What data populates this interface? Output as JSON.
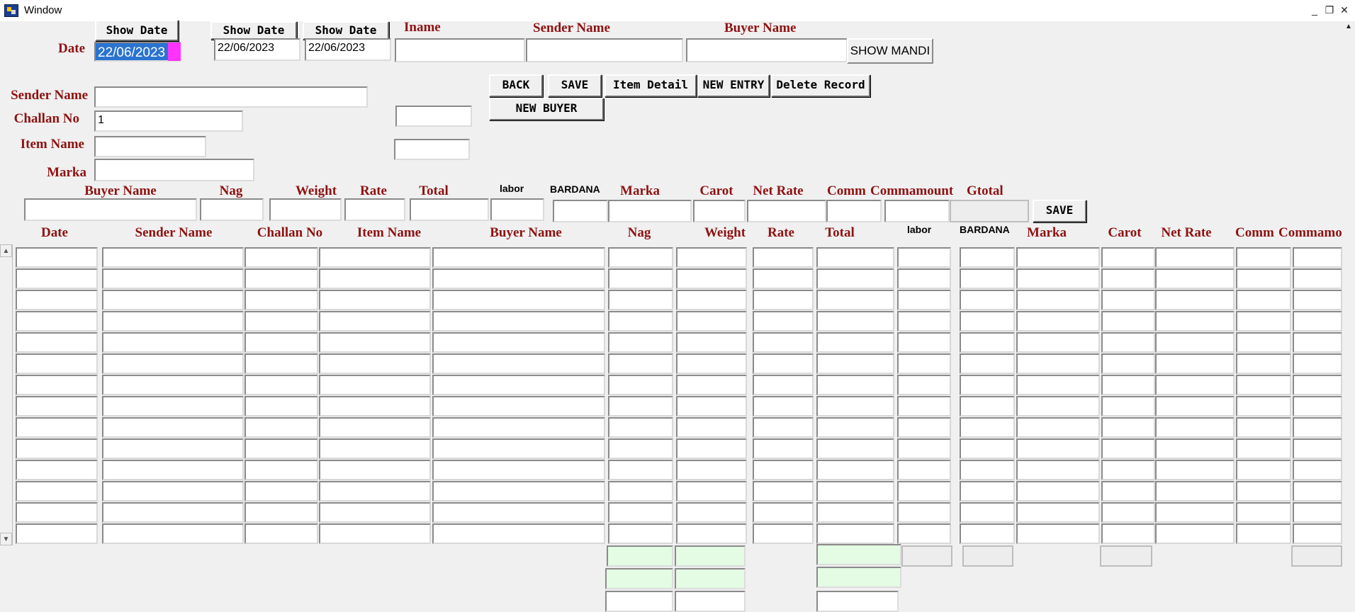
{
  "window": {
    "title": "Window",
    "minimize": "_",
    "restore": "❐",
    "close": "✕"
  },
  "top": {
    "date_label": "Date",
    "date_value": "22/06/2023",
    "show_date_1": "Show Date",
    "show_date_2": "Show Date",
    "show_date_3": "Show Date",
    "date_from": "22/06/2023",
    "date_to": "22/06/2023",
    "iname_label": "Iname",
    "sender_name_label": "Sender Name",
    "buyer_name_label": "Buyer Name",
    "show_mandi": "SHOW MANDI"
  },
  "form": {
    "sender_name_label": "Sender Name",
    "challan_no_label": "Challan No",
    "challan_no_value": "1",
    "item_name_label": "Item Name",
    "marka_label": "Marka"
  },
  "actions": {
    "back": "BACK",
    "save": "SAVE",
    "item_detail": "Item Detail",
    "new_entry": "NEW ENTRY",
    "delete_record": "Delete Record",
    "new_buyer": "NEW BUYER"
  },
  "entry": {
    "buyer_name": "Buyer Name",
    "nag": "Nag",
    "weight": "Weight",
    "rate": "Rate",
    "total": "Total",
    "labor": "labor",
    "bardana": "BARDANA",
    "marka": "Marka",
    "carot": "Carot",
    "net_rate": "Net Rate",
    "comm": "Comm",
    "commamount": "Commamount",
    "gtotal": "Gtotal",
    "save": "SAVE"
  },
  "grid": {
    "date": "Date",
    "sender_name": "Sender Name",
    "challan_no": "Challan No",
    "item_name": "Item Name",
    "buyer_name": "Buyer Name",
    "nag": "Nag",
    "weight": "Weight",
    "rate": "Rate",
    "total": "Total",
    "labor": "labor",
    "bardana": "BARDANA",
    "marka": "Marka",
    "carot": "Carot",
    "net_rate": "Net Rate",
    "comm": "Comm",
    "commamount": "Commamount",
    "rows": 14
  },
  "scroll": {
    "up": "▲",
    "down": "▼"
  },
  "colors": {
    "label": "#8e1212",
    "selection": "#2a73d0",
    "cursor": "#ff33ff",
    "total_cells": "#e4fbe4"
  }
}
